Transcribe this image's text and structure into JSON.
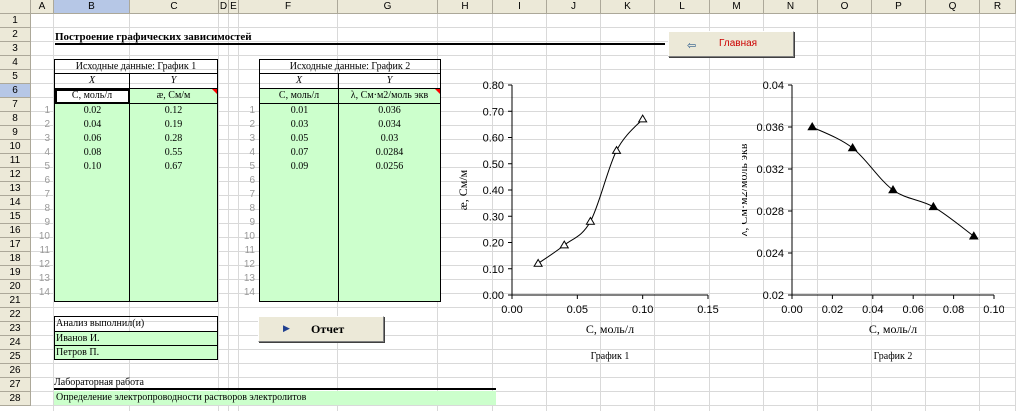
{
  "columns": [
    "A",
    "B",
    "C",
    "D",
    "E",
    "F",
    "G",
    "H",
    "I",
    "J",
    "K",
    "L",
    "M",
    "N",
    "O",
    "P",
    "Q",
    "R"
  ],
  "rows": [
    "1",
    "2",
    "3",
    "4",
    "5",
    "6",
    "7",
    "8",
    "9",
    "10",
    "11",
    "12",
    "13",
    "14",
    "15",
    "16",
    "17",
    "18",
    "19",
    "20",
    "21",
    "22",
    "23",
    "24",
    "25",
    "26",
    "27",
    "28"
  ],
  "sheet_title": "Построение графических зависимостей",
  "main_button": "Главная",
  "report_button": "Отчет",
  "table1": {
    "caption": "Исходные данные: График 1",
    "x_head": "X",
    "y_head": "Y",
    "x_unit": "C, моль/л",
    "y_unit": "æ, См/м",
    "index": [
      "1",
      "2",
      "3",
      "4",
      "5",
      "6",
      "7",
      "8",
      "9",
      "10",
      "11",
      "12",
      "13",
      "14"
    ],
    "x": [
      "0.02",
      "0.04",
      "0.06",
      "0.08",
      "0.10"
    ],
    "y": [
      "0.12",
      "0.19",
      "0.28",
      "0.55",
      "0.67"
    ]
  },
  "table2": {
    "caption": "Исходные данные: График 2",
    "x_head": "X",
    "y_head": "Y",
    "x_unit": "C, моль/л",
    "y_unit": "λ, См·м2/моль экв",
    "index": [
      "1",
      "2",
      "3",
      "4",
      "5",
      "6",
      "7",
      "8",
      "9",
      "10",
      "11",
      "12",
      "13",
      "14"
    ],
    "x": [
      "0.01",
      "0.03",
      "0.05",
      "0.07",
      "0.09"
    ],
    "y": [
      "0.036",
      "0.034",
      "0.03",
      "0.0284",
      "0.0256"
    ]
  },
  "authors": {
    "caption": "Анализ выполнил(и)",
    "names": [
      "Иванов И.",
      "Петров П."
    ]
  },
  "lab": {
    "caption": "Лабораторная работа",
    "topic": "Определение электропроводности растворов электролитов"
  },
  "colors": {
    "green": "#ccffcc",
    "header": "#ece9d8",
    "button_text": "#cc0000"
  },
  "chart_data": [
    {
      "type": "line",
      "title": "График 1",
      "xlabel": "C, моль/л",
      "ylabel": "æ, См/м",
      "xlim": [
        0,
        0.15
      ],
      "ylim": [
        0,
        0.8
      ],
      "xticks": [
        "0.00",
        "0.05",
        "0.10",
        "0.15"
      ],
      "yticks": [
        "0.00",
        "0.10",
        "0.20",
        "0.30",
        "0.40",
        "0.50",
        "0.60",
        "0.70",
        "0.80"
      ],
      "x": [
        0.02,
        0.04,
        0.06,
        0.08,
        0.1
      ],
      "y": [
        0.12,
        0.19,
        0.28,
        0.55,
        0.67
      ],
      "marker": "open-triangle"
    },
    {
      "type": "line",
      "title": "График 2",
      "xlabel": "C, моль/л",
      "ylabel": "λ, См·м2/моль экв",
      "xlim": [
        0,
        0.1
      ],
      "ylim": [
        0.02,
        0.04
      ],
      "xticks": [
        "0.00",
        "0.02",
        "0.04",
        "0.06",
        "0.08",
        "0.10"
      ],
      "yticks": [
        "0.02",
        "0.024",
        "0.028",
        "0.032",
        "0.036",
        "0.04"
      ],
      "x": [
        0.01,
        0.03,
        0.05,
        0.07,
        0.09
      ],
      "y": [
        0.036,
        0.034,
        0.03,
        0.0284,
        0.0256
      ],
      "marker": "filled-triangle"
    }
  ]
}
